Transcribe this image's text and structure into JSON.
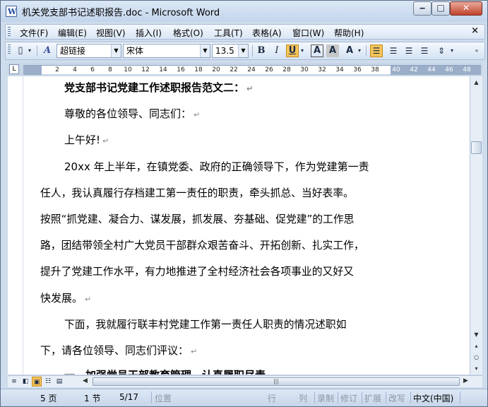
{
  "window": {
    "title": "机关党支部书记述职报告.doc - Microsoft Word",
    "app_icon": "W",
    "minimize": "‒",
    "maximize": "□",
    "close": "✕"
  },
  "menubar": {
    "items": [
      "文件(F)",
      "编辑(E)",
      "视图(V)",
      "插入(I)",
      "格式(O)",
      "工具(T)",
      "表格(A)",
      "窗口(W)",
      "帮助(H)"
    ],
    "close_doc": "×"
  },
  "toolbar": {
    "style_value": "超链接",
    "font_value": "宋体",
    "size_value": "13.5",
    "bold": "B",
    "italic": "I",
    "underline": "U",
    "styles_icon": "A",
    "char_border": "A",
    "char_shading": "A",
    "highlight": "A"
  },
  "ruler": {
    "corner": "L",
    "ticks": [
      "2",
      "4",
      "6",
      "8",
      "10",
      "12",
      "14",
      "16",
      "18",
      "20",
      "22",
      "24",
      "26",
      "28",
      "30",
      "32",
      "34",
      "36",
      "38",
      "40",
      "42",
      "44",
      "46",
      "48"
    ]
  },
  "document": {
    "paragraphs": [
      "党支部书记党建工作述职报告范文二：",
      "尊敬的各位领导、同志们：",
      "上午好!",
      "20xx 年上半年，在镇党委、政府的正确领导下，作为党建第一责",
      "任人，我认真履行存档建工第一责任的职责，牵头抓总、当好表率。",
      "按照“抓党建、凝合力、谋发展，抓发展、夯基础、促党建”的工作思",
      "路，团结带领全村广大党员干部群众艰苦奋斗、开拓创新、扎实工作，",
      "提升了党建工作水平，有力地推进了全村经济社会各项事业的又好又",
      "快发展。",
      "下面，我就履行联丰村党建工作第一责任人职责的情况述职如",
      "下，请各位领导、同志们评议：",
      "一、加强党员干部教育管理，认真履职尽责"
    ],
    "paragraph_mark": "↵"
  },
  "statusbar": {
    "page": "5 页",
    "section": "1 节",
    "page_of": "5/17",
    "position": "位置",
    "line": "行",
    "column": "列",
    "rec": "录制",
    "trk": "修订",
    "ext": "扩展",
    "ovr": "改写",
    "language": "中文(中国)"
  },
  "colors": {
    "active_button": "#f6c55a",
    "close_button": "#c0432c",
    "chrome": "#cfdcec"
  }
}
